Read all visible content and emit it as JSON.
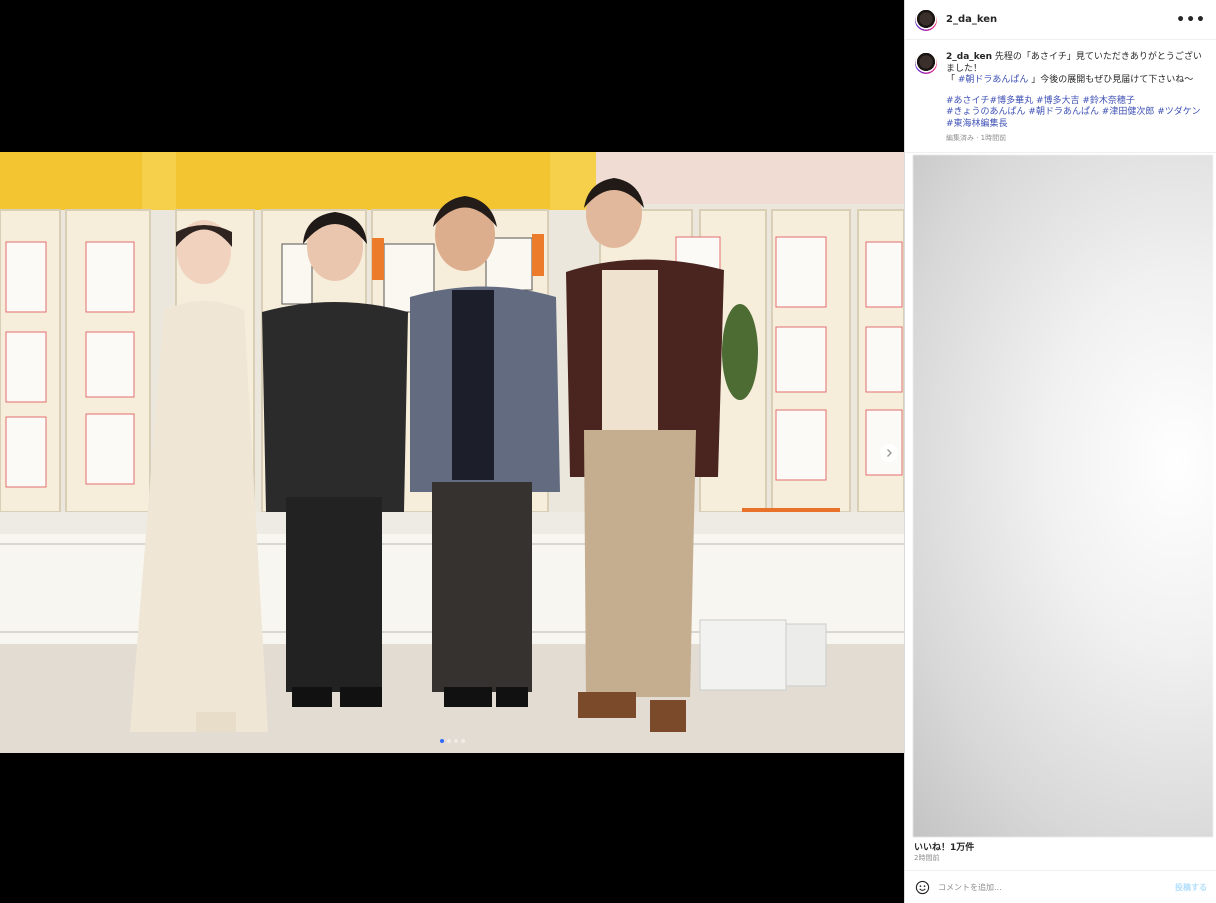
{
  "post": {
    "username": "2_da_ken",
    "more_icon": "•••",
    "caption": {
      "username": "2_da_ken",
      "line1": "先程の「あさイチ」見ていただきありがとうございました！",
      "line2_pre": "「 ",
      "line2_tag": "#朝ドラあんぱん",
      "line2_post": " 」今後の展開もぜひ見届けて下さいね〜",
      "hashtags_1": "#あさイチ#博多華丸 #博多大吉 #鈴木奈穂子",
      "hashtags_2": "#きょうのあんぱん #朝ドラあんぱん #津田健次郎 #ツダケン #東海林編集長",
      "meta": "編集済み · 1時間前"
    },
    "likes": "いいね！1万件",
    "time_ago": "2時間前",
    "comment_placeholder": "コメントを追加...",
    "post_button": "投稿する"
  },
  "media": {
    "carousel_dots": 4,
    "active_dot": 0,
    "next_icon": "chevron-right-icon"
  },
  "colors": {
    "hashtag": "#3f51b5",
    "muted": "#8e8e8e",
    "post_button": "#b2dffc"
  }
}
